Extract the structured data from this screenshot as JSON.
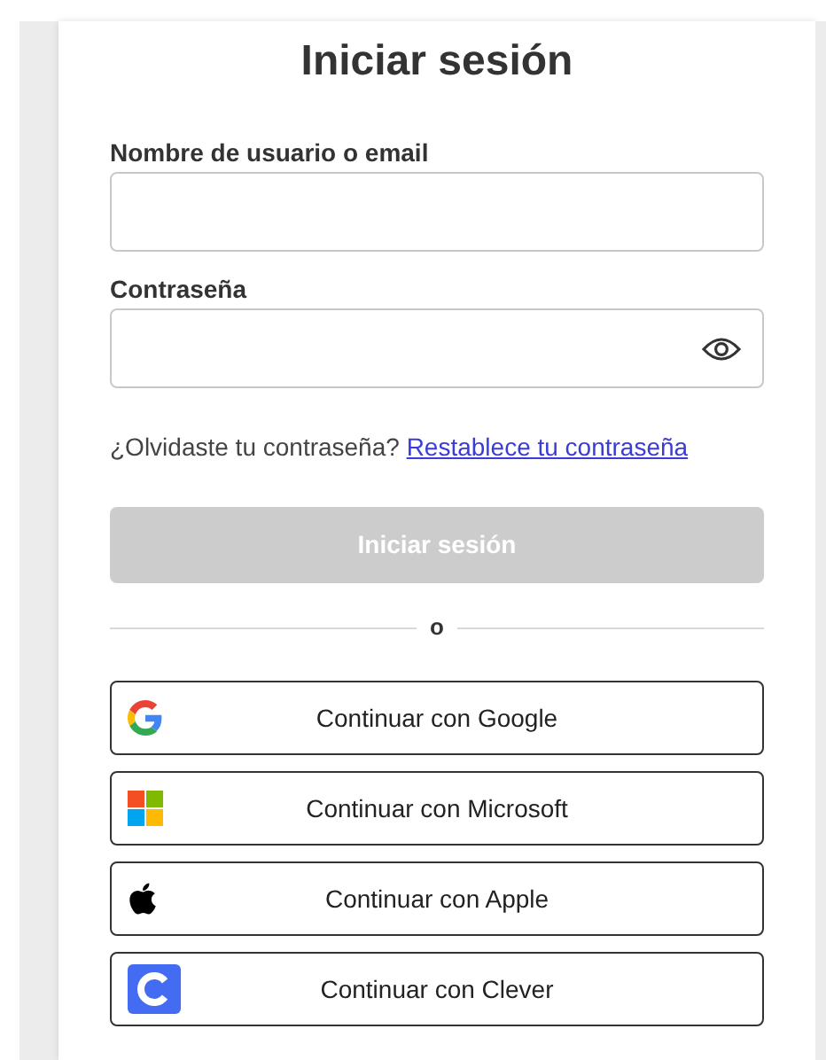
{
  "title": "Iniciar sesión",
  "fields": [
    {
      "label": "Nombre de usuario o email",
      "kind": "text"
    },
    {
      "label": "Contraseña",
      "kind": "password"
    }
  ],
  "forgot": {
    "text": "¿Olvidaste tu contraseña?",
    "link": "Restablece tu contraseña"
  },
  "submit": {
    "label": "Iniciar sesión",
    "disabled": true
  },
  "divider": "o",
  "providers": [
    {
      "kind": "google",
      "label": "Continuar con Google"
    },
    {
      "kind": "microsoft",
      "label": "Continuar con Microsoft"
    },
    {
      "kind": "apple",
      "label": "Continuar con Apple"
    },
    {
      "kind": "clever",
      "label": "Continuar con Clever"
    }
  ]
}
